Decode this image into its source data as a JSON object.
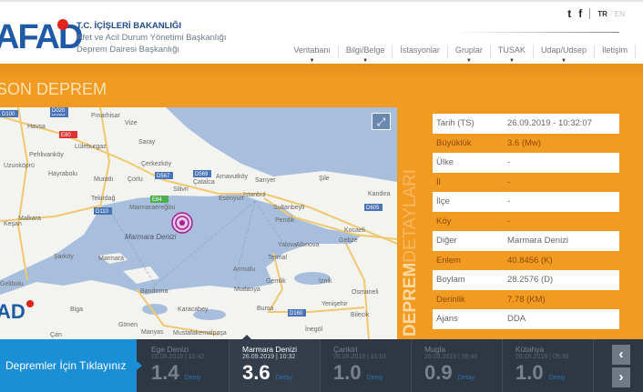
{
  "header": {
    "logo_text": "AFAD",
    "ministry": "T.C. İÇİŞLERİ BAKANLIĞI",
    "agency": "Afet ve Acil Durum Yönetimi Başkanlığı",
    "department": "Deprem Dairesi Başkanlığı",
    "social": [
      "twitter-icon",
      "facebook-icon"
    ],
    "lang": {
      "tr": "TR",
      "en": "EN"
    },
    "nav": [
      {
        "label": "Veritabanı",
        "dropdown": true
      },
      {
        "label": "Bilgi/Belge",
        "dropdown": true
      },
      {
        "label": "İstasyonlar",
        "dropdown": false
      },
      {
        "label": "Gruplar",
        "dropdown": true
      },
      {
        "label": "TUSAK",
        "dropdown": true
      },
      {
        "label": "Udap/Udsep",
        "dropdown": true
      },
      {
        "label": "İletişim",
        "dropdown": false
      }
    ]
  },
  "section_title": "SON DEPREM",
  "map": {
    "sea_label": "Marmara Denizi",
    "labels": [
      "Pınarhisar",
      "Vize",
      "Havsa",
      "Lüleburgaz",
      "Saray",
      "Pehlivanköy",
      "Uzunköprü",
      "Hayrabolu",
      "Çerkezköy",
      "Muratlı",
      "Çorlu",
      "Çatalca",
      "Arnavutköy",
      "Sarıyer",
      "Şile",
      "Silivri",
      "Esenyurt",
      "İstanbul",
      "Kandıra",
      "Tekirdağ",
      "Marmaraereğlisi",
      "Sultanbeyli",
      "Pendik",
      "Malkara",
      "Keşan",
      "Gebze",
      "Kocaeli",
      "Yalova",
      "Altınova",
      "Şarköy",
      "Marmara",
      "Termal",
      "Armutlu",
      "Gemlik",
      "İznik",
      "Gelibolu",
      "Bandırma",
      "Mudanya",
      "Osmaneli",
      "Biga",
      "Karacabey",
      "Bursa",
      "Yenişehir",
      "Bilecik",
      "Gönen",
      "Manyas",
      "Mustafakemalpaşa",
      "İnegöl",
      "Çan"
    ],
    "road_badges": [
      "D100",
      "D565",
      "E80",
      "D567",
      "D569",
      "E84",
      "D110",
      "D605",
      "D160",
      "D020"
    ],
    "expand_icon": "expand-icon",
    "marker_color": "#a0208f"
  },
  "details": {
    "title_bold": "DEPREM",
    "title_light": "DETAYLARI",
    "rows": [
      {
        "key": "Tarih (TS)",
        "value": "26.09.2019 - 10:32:07"
      },
      {
        "key": "Büyüklük",
        "value": "3.6 (Mw)"
      },
      {
        "key": "Ülke",
        "value": "-"
      },
      {
        "key": "İl",
        "value": "-"
      },
      {
        "key": "İlçe",
        "value": "-"
      },
      {
        "key": "Köy",
        "value": "-"
      },
      {
        "key": "Diğer",
        "value": "Marmara Denizi"
      },
      {
        "key": "Enlem",
        "value": "40.8456 (K)"
      },
      {
        "key": "Boylam",
        "value": "28.2576 (D)"
      },
      {
        "key": "Derinlik",
        "value": "7.78 (KM)"
      },
      {
        "key": "Ajans",
        "value": "DDA"
      }
    ]
  },
  "bottom": {
    "cta": "Depremler İçin Tıklayınız",
    "quakes": [
      {
        "place": "Ege Denizi",
        "datetime": "26.09.2019 | 10:42",
        "mag": "1.4",
        "detail": "Detay"
      },
      {
        "place": "Marmara Denizi",
        "datetime": "26.09.2019 | 10:32",
        "mag": "3.6",
        "detail": "Detay"
      },
      {
        "place": "Çankiri",
        "datetime": "26.09.2019 | 10:01",
        "mag": "1.0",
        "detail": "Detay"
      },
      {
        "place": "Mugla",
        "datetime": "26.09.2019 | 09:40",
        "mag": "0.9",
        "detail": "Detay"
      },
      {
        "place": "Kütahya",
        "datetime": "26.09.2019 | 09:30",
        "mag": "1.0",
        "detail": "Detay"
      }
    ],
    "prev": "‹",
    "next": "›"
  },
  "colors": {
    "orange": "#f29b22",
    "blue": "#1a8fd6",
    "dark": "#2e3844",
    "sea": "#a7bfdd"
  }
}
